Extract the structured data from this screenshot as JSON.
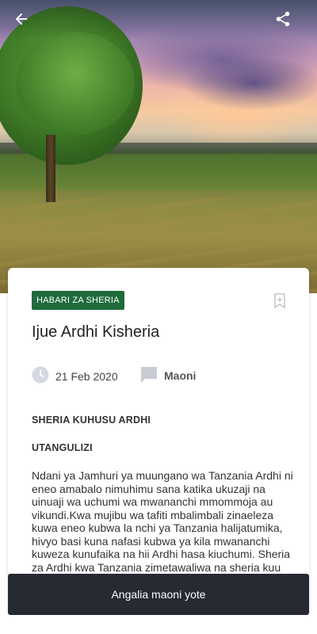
{
  "header": {
    "back_icon": "arrow-left-icon",
    "share_icon": "share-icon"
  },
  "article": {
    "category": "HABARI ZA SHERIA",
    "bookmark_icon": "bookmark-icon",
    "title": "Ijue Ardhi Kisheria",
    "date_icon": "clock-icon",
    "date": "21 Feb 2020",
    "comments_icon": "comment-icon",
    "comments_label": "Maoni",
    "heading_1": "SHERIA KUHUSU ARDHI",
    "heading_2": "UTANGULIZI",
    "body": "Ndani ya Jamhuri ya muungano wa Tanzania Ardhi ni eneo amabalo nimuhimu sana katika ukuzaji na uinuaji wa uchumi wa mwananchi mmommoja au vikundi.Kwa mujibu wa tafiti mbalimbali zinaeleza kuwa eneo kubwa la nchi ya Tanzania halijatumika, hivyo basi kuna nafasi kubwa ya kila mwananchi kuweza kunufaika na hii Ardhi hasa kiuchumi. Sheria za Ardhi kwa Tanzania zimetawaliwa na sheria kuu mbili ambazo ni:"
  },
  "footer": {
    "all_comments_label": "Angalia maoni yote"
  },
  "colors": {
    "badge": "#1f6b3b",
    "cta": "#262a33"
  }
}
